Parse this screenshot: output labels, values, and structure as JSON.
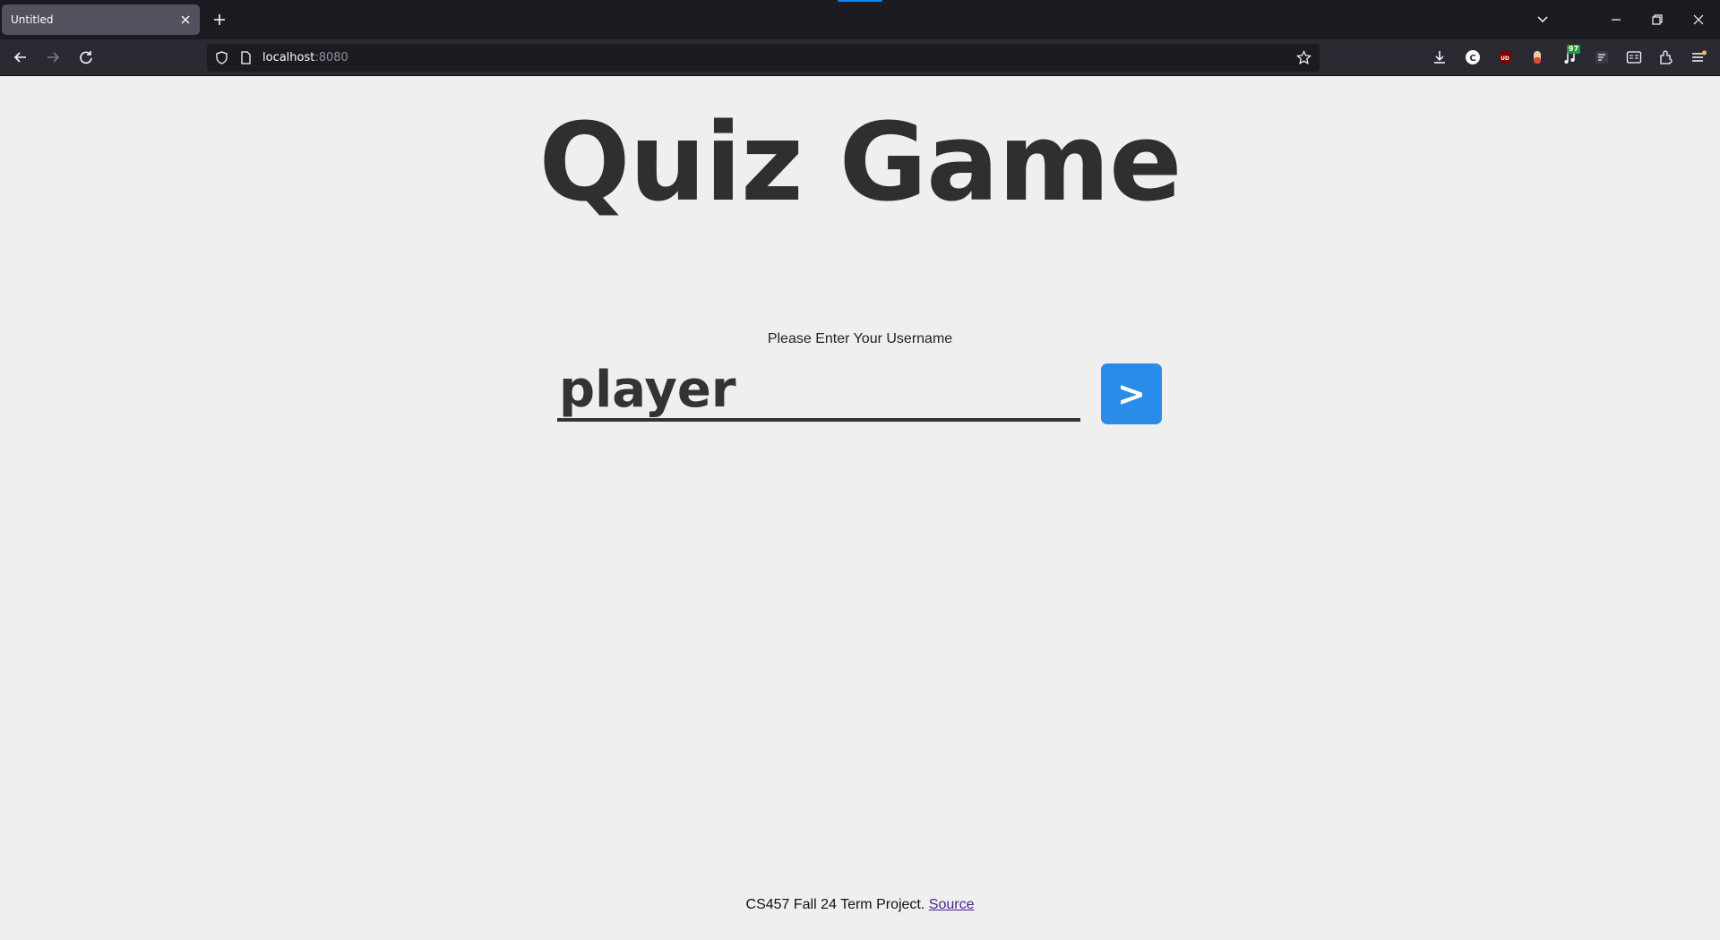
{
  "browser": {
    "tab_title": "Untitled",
    "url_host": "localhost",
    "url_port": ":8080",
    "extension_badge": "97"
  },
  "page": {
    "title": "Quiz Game",
    "prompt": "Please Enter Your Username",
    "username_value": "player",
    "submit_label": ">",
    "footer_text": "CS457 Fall 24 Term Project.",
    "footer_link": "Source"
  },
  "colors": {
    "background": "#efefef",
    "accent_button": "#2b8be8",
    "title_text": "#2f2f2f"
  }
}
